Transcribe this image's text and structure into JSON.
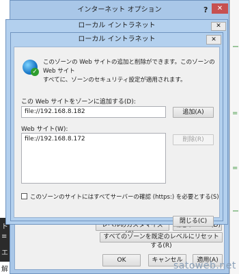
{
  "outer_window": {
    "title": "インターネット オプション",
    "help": "?",
    "close": "✕",
    "buttons": {
      "custom_level": "レベルのカスタマイズ(C)...",
      "default_level": "既定のレベル(D)",
      "reset_all": "すべてのゾーンを既定のレベルにリセットする(R)",
      "ok": "OK",
      "cancel": "キャンセル",
      "apply": "適用(A)"
    }
  },
  "middle_window": {
    "title": "ローカル イントラネット",
    "close": "✕"
  },
  "dialog": {
    "title": "ローカル イントラネット",
    "close": "✕",
    "info_line1": "このゾーンの Web サイトの追加と削除ができます。このゾーンの Web サイト",
    "info_line2": "すべてに、ゾーンのセキュリティ設定が適用されます。",
    "add_label": "この Web サイトをゾーンに追加する(D):",
    "add_value": "file://192.168.8.182",
    "add_button": "追加(A)",
    "list_label": "Web サイト(W):",
    "sites": [
      "file://192.168.8.172"
    ],
    "remove_button": "削除(R)",
    "https_checkbox_label": "このゾーンのサイトにはすべてサーバーの確認 (https:) を必要とする(S)",
    "https_checked": false,
    "close_button": "閉じる(C)"
  },
  "background": {
    "left_glyphs": [
      "ト",
      "≡",
      "エ",
      "ト",
      "解"
    ],
    "right_glyphs": [
      "ー",
      "=",
      "=",
      "ー"
    ]
  },
  "watermark": "satoweb.net"
}
